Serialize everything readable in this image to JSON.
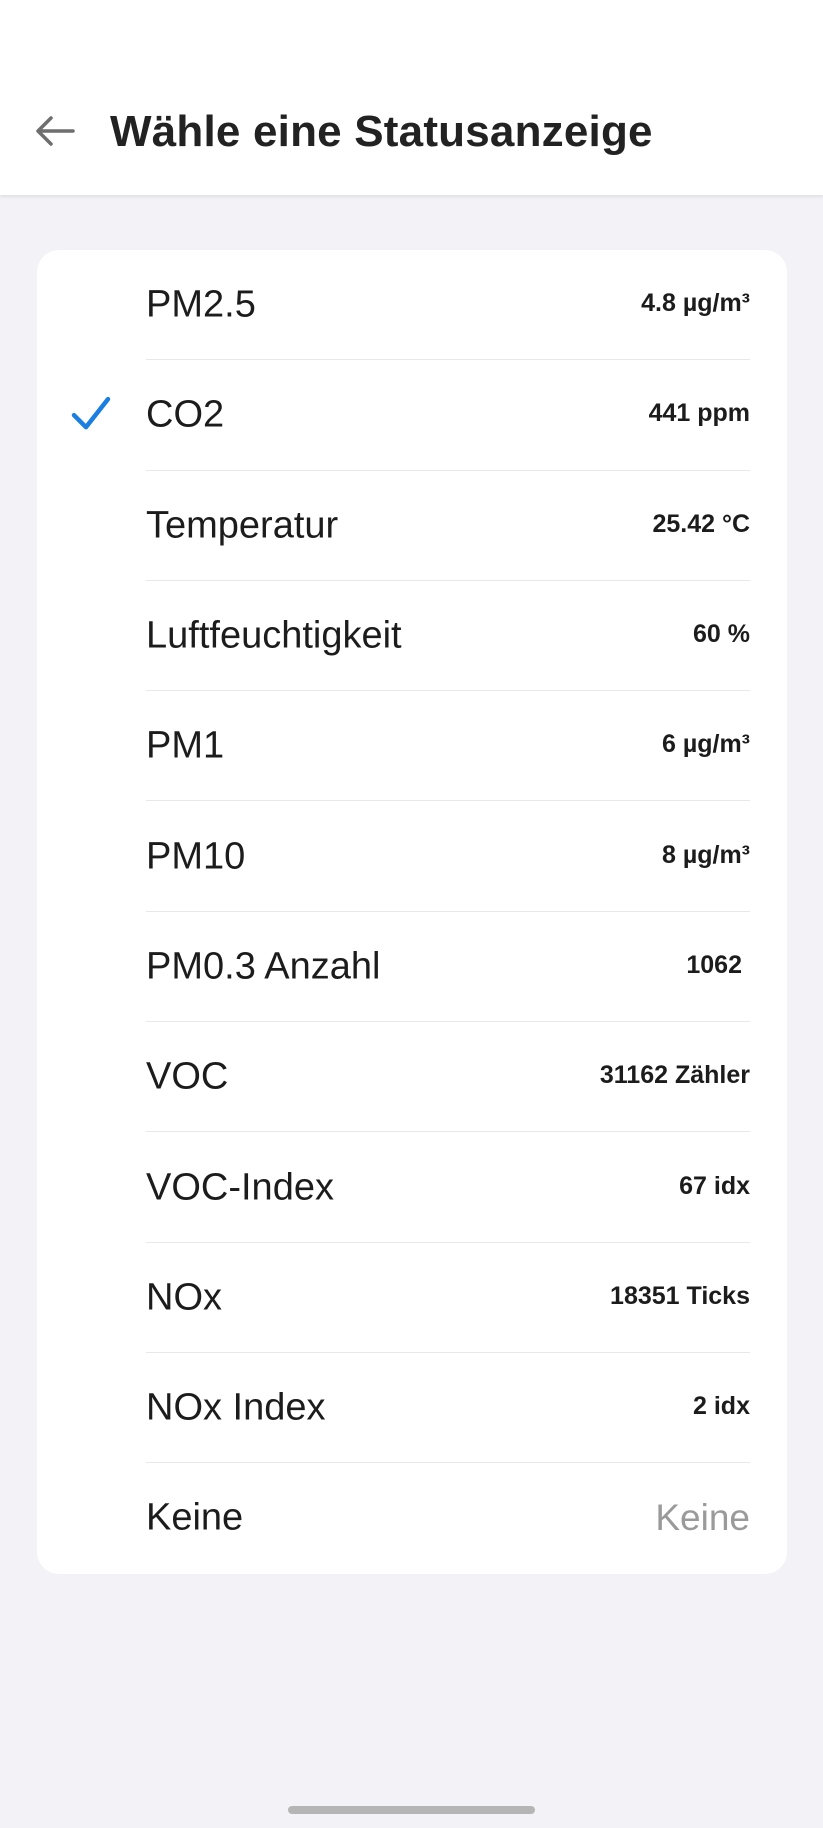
{
  "header": {
    "title": "Wähle eine Statusanzeige",
    "back_icon": "arrow-left-icon"
  },
  "list": {
    "selected_icon": "checkmark-icon",
    "accent_color": "#1a7fe0",
    "items": [
      {
        "label": "PM2.5",
        "value": "4.8 µg/m³",
        "selected": false
      },
      {
        "label": "CO2",
        "value": "441 ppm",
        "selected": true
      },
      {
        "label": "Temperatur",
        "value": "25.42 °C",
        "selected": false
      },
      {
        "label": "Luftfeuchtigkeit",
        "value": "60 %",
        "selected": false
      },
      {
        "label": "PM1",
        "value": "6 µg/m³",
        "selected": false
      },
      {
        "label": "PM10",
        "value": "8 µg/m³",
        "selected": false
      },
      {
        "label": "PM0.3 Anzahl",
        "value": "1062",
        "selected": false
      },
      {
        "label": "VOC",
        "value": "31162 Zähler",
        "selected": false
      },
      {
        "label": "VOC-Index",
        "value": "67 idx",
        "selected": false
      },
      {
        "label": "NOx",
        "value": "18351 Ticks",
        "selected": false
      },
      {
        "label": "NOx Index",
        "value": "2 idx",
        "selected": false
      },
      {
        "label": "Keine",
        "value": "Keine",
        "selected": false,
        "muted": true
      }
    ]
  }
}
